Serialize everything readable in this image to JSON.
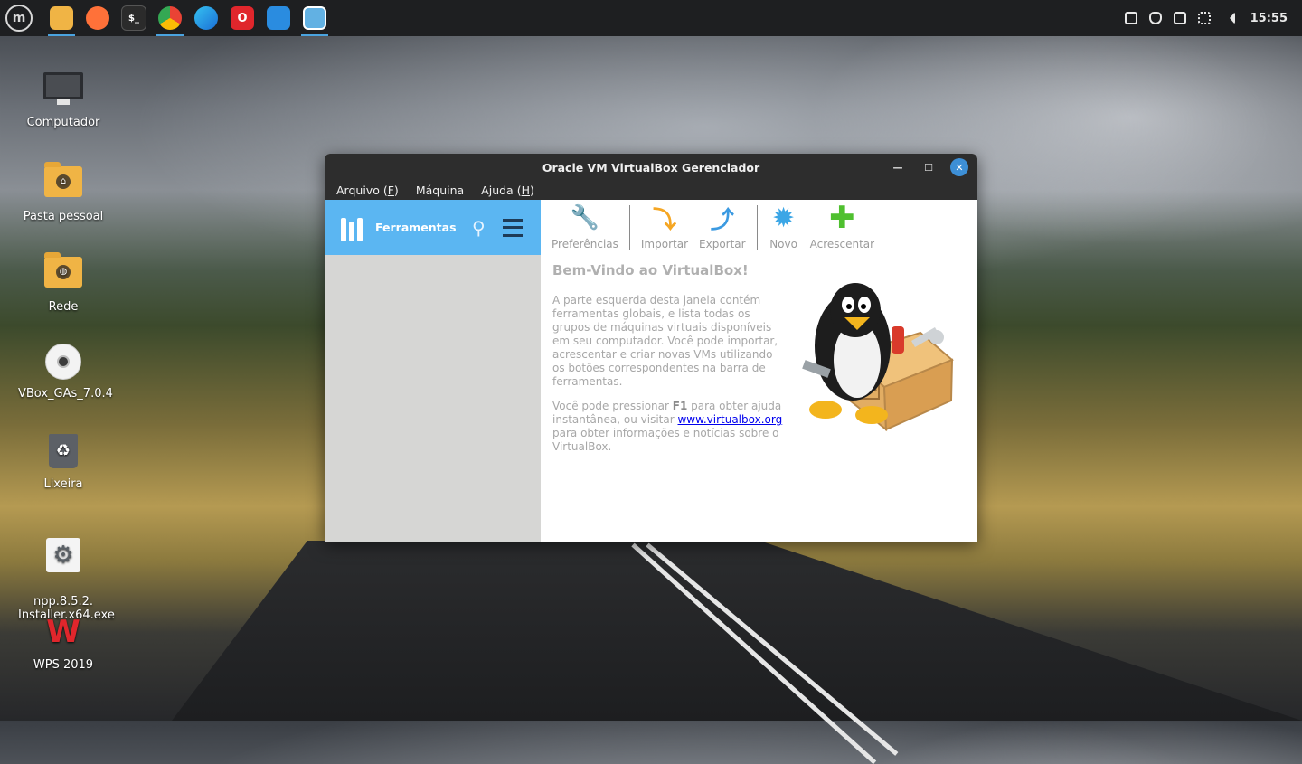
{
  "taskbar": {
    "apps": [
      {
        "name": "menu",
        "icon": "linux-mint-logo-icon"
      },
      {
        "name": "files",
        "icon": "folder-icon",
        "color": "#f0b445"
      },
      {
        "name": "firefox",
        "icon": "firefox-icon",
        "color": "#ff7139"
      },
      {
        "name": "terminal",
        "icon": "terminal-icon",
        "glyph": "$_",
        "color": "#2b2b2b"
      },
      {
        "name": "chrome",
        "icon": "chrome-icon",
        "color": "#34a853"
      },
      {
        "name": "edge",
        "icon": "edge-icon",
        "color": "#1b8fd6"
      },
      {
        "name": "opera",
        "icon": "opera-icon",
        "glyph": "O",
        "color": "#e0262c"
      },
      {
        "name": "vscode",
        "icon": "vscode-icon",
        "color": "#2a8ce0"
      },
      {
        "name": "virtualbox",
        "icon": "virtualbox-icon",
        "color": "#62b1e3"
      }
    ],
    "clock": "15:55"
  },
  "desktop": {
    "icons": [
      {
        "label": "Computador",
        "icon": "computer-icon"
      },
      {
        "label": "Pasta pessoal",
        "icon": "home-folder-icon"
      },
      {
        "label": "Rede",
        "icon": "network-folder-icon"
      },
      {
        "label": "VBox_GAs_7.0.4",
        "icon": "disc-icon"
      },
      {
        "label": "Lixeira",
        "icon": "trash-icon"
      },
      {
        "label": "npp.8.5.2.\nInstaller.x64.exe",
        "icon": "settings-file-icon"
      },
      {
        "label": "WPS 2019",
        "icon": "wps-icon"
      }
    ]
  },
  "window": {
    "title": "Oracle VM VirtualBox Gerenciador",
    "menu": [
      {
        "label": "Arquivo",
        "mnemonic": "F"
      },
      {
        "label": "Máquina"
      },
      {
        "label": "Ajuda",
        "mnemonic": "H"
      }
    ],
    "sidebar": {
      "tools_label": "Ferramentas"
    },
    "toolbar": {
      "preferences": "Preferências",
      "import": "Importar",
      "export": "Exportar",
      "new": "Novo",
      "add": "Acrescentar"
    },
    "welcome": {
      "title": "Bem-Vindo ao VirtualBox!",
      "p1": "A parte esquerda desta janela contém ferramentas globais, e lista todas os grupos de máquinas virtuais disponíveis em seu computador. Você pode importar, acrescentar e criar novas VMs utilizando os botões correspondentes na barra de ferramentas.",
      "p2_pre": "Você pode pressionar ",
      "p2_key": "F1",
      "p2_mid": " para obter ajuda instantânea, ou visitar ",
      "p2_link": "www.virtualbox.org",
      "p2_post": " para obter informações e notícias sobre o VirtualBox."
    }
  }
}
